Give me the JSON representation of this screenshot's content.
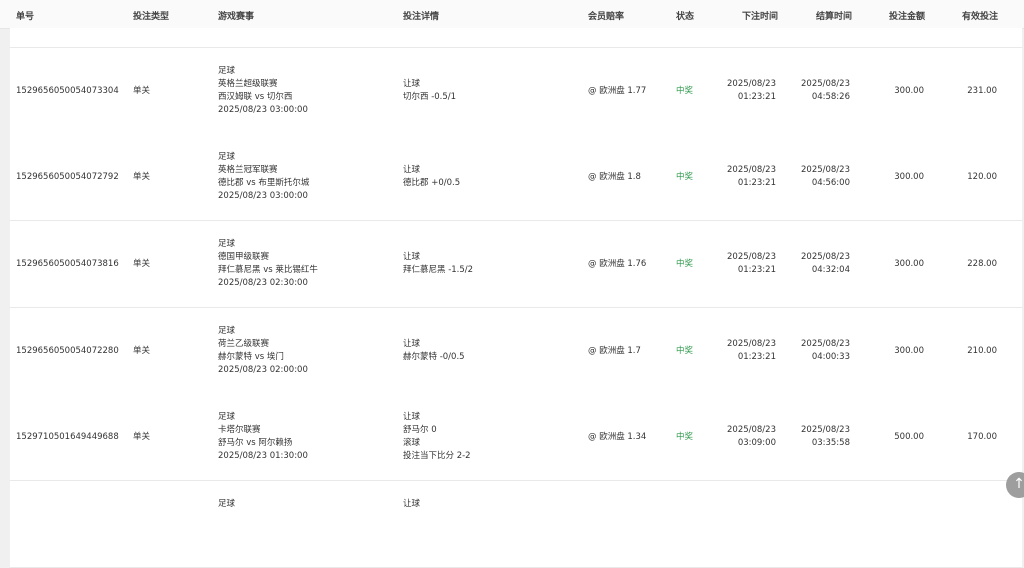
{
  "columns": {
    "order_no": "单号",
    "bet_type": "投注类型",
    "match": "游戏赛事",
    "bet_detail": "投注详情",
    "odds": "会员赔率",
    "status": "状态",
    "bet_time": "下注时间",
    "settle_time": "结算时间",
    "amount": "投注金额",
    "valid_bet": "有效投注"
  },
  "rows": [
    {
      "order_no": "1529656050054073304",
      "bet_type": "单关",
      "match": [
        "足球",
        "英格兰超级联赛",
        "西汉姆联 vs 切尔西",
        "2025/08/23 03:00:00"
      ],
      "bet_detail": [
        "让球",
        "切尔西 -0.5/1"
      ],
      "odds": "@ 欧洲盘 1.77",
      "status": "中奖",
      "bet_time": [
        "2025/08/23",
        "01:23:21"
      ],
      "settle_time": [
        "2025/08/23",
        "04:58:26"
      ],
      "amount": "300.00",
      "valid_bet": "231.00"
    },
    {
      "order_no": "1529656050054072792",
      "bet_type": "单关",
      "match": [
        "足球",
        "英格兰冠军联赛",
        "德比郡 vs 布里斯托尔城",
        "2025/08/23 03:00:00"
      ],
      "bet_detail": [
        "让球",
        "德比郡 +0/0.5"
      ],
      "odds": "@ 欧洲盘 1.8",
      "status": "中奖",
      "bet_time": [
        "2025/08/23",
        "01:23:21"
      ],
      "settle_time": [
        "2025/08/23",
        "04:56:00"
      ],
      "amount": "300.00",
      "valid_bet": "120.00"
    },
    {
      "order_no": "1529656050054073816",
      "bet_type": "单关",
      "match": [
        "足球",
        "德国甲级联赛",
        "拜仁慕尼黑 vs 莱比锡红牛",
        "2025/08/23 02:30:00"
      ],
      "bet_detail": [
        "让球",
        "拜仁慕尼黑 -1.5/2"
      ],
      "odds": "@ 欧洲盘 1.76",
      "status": "中奖",
      "bet_time": [
        "2025/08/23",
        "01:23:21"
      ],
      "settle_time": [
        "2025/08/23",
        "04:32:04"
      ],
      "amount": "300.00",
      "valid_bet": "228.00"
    },
    {
      "order_no": "1529656050054072280",
      "bet_type": "单关",
      "match": [
        "足球",
        "荷兰乙级联赛",
        "赫尔蒙特 vs 埃门",
        "2025/08/23 02:00:00"
      ],
      "bet_detail": [
        "让球",
        "赫尔蒙特 -0/0.5"
      ],
      "odds": "@ 欧洲盘 1.7",
      "status": "中奖",
      "bet_time": [
        "2025/08/23",
        "01:23:21"
      ],
      "settle_time": [
        "2025/08/23",
        "04:00:33"
      ],
      "amount": "300.00",
      "valid_bet": "210.00"
    },
    {
      "order_no": "1529710501649449688",
      "bet_type": "单关",
      "match": [
        "足球",
        "卡塔尔联赛",
        "舒马尔 vs 阿尔赖扬",
        "2025/08/23 01:30:00"
      ],
      "bet_detail": [
        "让球",
        "舒马尔 0",
        "滚球",
        "投注当下比分 2-2"
      ],
      "odds": "@ 欧洲盘 1.34",
      "status": "中奖",
      "bet_time": [
        "2025/08/23",
        "03:09:00"
      ],
      "settle_time": [
        "2025/08/23",
        "03:35:58"
      ],
      "amount": "500.00",
      "valid_bet": "170.00"
    }
  ],
  "partial_row": {
    "match": [
      "足球"
    ],
    "bet_detail": [
      "让球"
    ]
  },
  "scroll_top_icon": "arrow-up-icon"
}
